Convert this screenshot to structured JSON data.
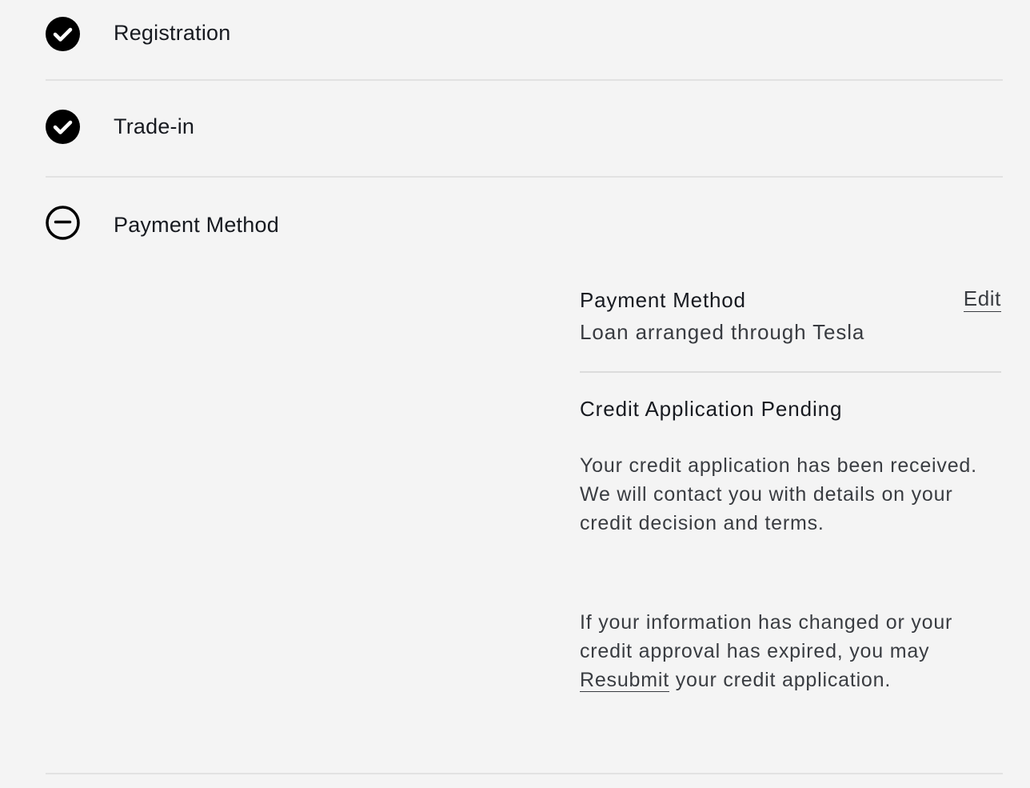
{
  "steps": [
    {
      "label": "Registration",
      "status": "complete",
      "icon": "check-circle-icon"
    },
    {
      "label": "Trade-in",
      "status": "complete",
      "icon": "check-circle-icon"
    },
    {
      "label": "Payment Method",
      "status": "in-progress",
      "icon": "minus-circle-icon"
    }
  ],
  "payment": {
    "title": "Payment Method",
    "edit_label": "Edit",
    "value": "Loan arranged through Tesla"
  },
  "credit": {
    "title": "Credit Application Pending",
    "paragraph1": "Your credit application has been received. We will contact you with details on your credit decision and terms.",
    "paragraph2_before": "If your information has changed or your credit approval has expired, you may ",
    "resubmit_label": "Resubmit",
    "paragraph2_after": " your credit application."
  },
  "colors": {
    "background": "#f4f4f4",
    "text_primary": "#171a20",
    "text_secondary": "#393c41",
    "divider": "#e2e2e2"
  }
}
